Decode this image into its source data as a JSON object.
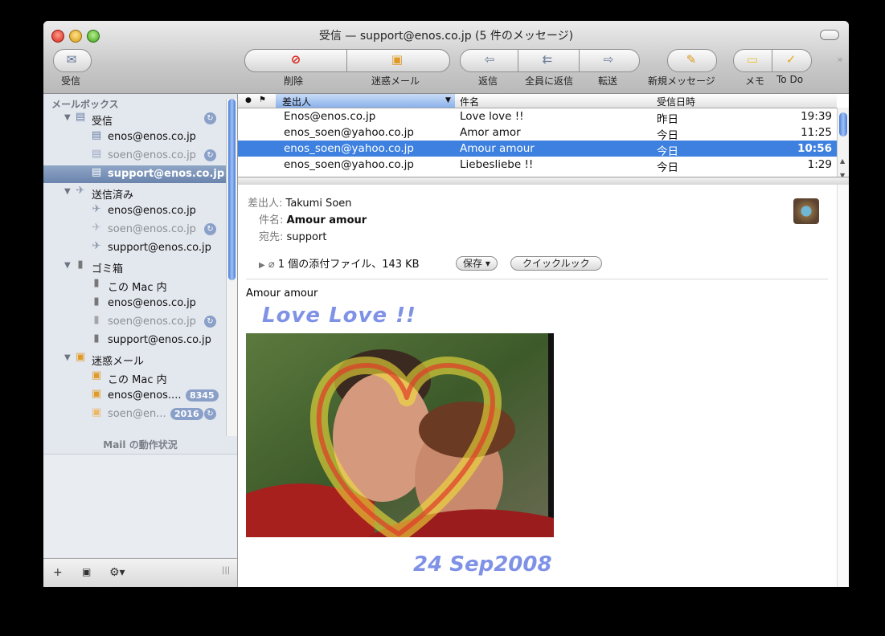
{
  "window": {
    "title": "受信 — support@enos.co.jp (5 件のメッセージ)"
  },
  "toolbar": {
    "get_mail": "受信",
    "delete": "削除",
    "junk": "迷惑メール",
    "reply": "返信",
    "reply_all": "全員に返信",
    "forward": "転送",
    "new_message": "新規メッセージ",
    "note": "メモ",
    "todo": "To Do"
  },
  "sidebar": {
    "header": "メールボックス",
    "inbox": "受信",
    "inbox_items": [
      "enos@enos.co.jp",
      "soen@enos.co.jp",
      "support@enos.co.jp"
    ],
    "sent": "送信済み",
    "sent_items": [
      "enos@enos.co.jp",
      "soen@enos.co.jp",
      "support@enos.co.jp"
    ],
    "trash": "ゴミ箱",
    "trash_items": [
      "この Mac 内",
      "enos@enos.co.jp",
      "soen@enos.co.jp",
      "support@enos.co.jp"
    ],
    "junk": "迷惑メール",
    "junk_items": [
      "この Mac 内",
      "enos@enos....",
      "soen@en..."
    ],
    "junk_counts": [
      "8345",
      "2016"
    ],
    "activity": "Mail の動作状況"
  },
  "list": {
    "columns": {
      "from": "差出人",
      "subject": "件名",
      "date": "受信日時"
    },
    "rows": [
      {
        "from": "Enos@enos.co.jp",
        "subject": "Love love !!",
        "date": "昨日",
        "time": "19:39"
      },
      {
        "from": "enos_soen@yahoo.co.jp",
        "subject": "Amor amor",
        "date": "今日",
        "time": "11:25"
      },
      {
        "from": "enos_soen@yahoo.co.jp",
        "subject": "Amour amour",
        "date": "今日",
        "time": "10:56"
      },
      {
        "from": "enos_soen@yahoo.co.jp",
        "subject": "Liebesliebe !!",
        "date": "今日",
        "time": "1:29"
      }
    ]
  },
  "message": {
    "from_label": "差出人:",
    "from": "Takumi Soen",
    "subject_label": "件名:",
    "subject": "Amour amour",
    "to_label": "宛先:",
    "to": "support",
    "attachments": "1 個の添付ファイル、143 KB",
    "save": "保存 ▾",
    "quicklook": "クイックルック",
    "body": "Amour amour",
    "handwriting_top": "Love Love !!",
    "handwriting_date": "24 Sep2008"
  },
  "colors": {
    "selection": "#3d80df",
    "sidebar_bg": "#e3e7ee",
    "handwriting": "#7f92e6"
  },
  "icons": [
    "get-mail-icon",
    "delete-icon",
    "junk-icon",
    "reply-icon",
    "reply-all-icon",
    "forward-icon",
    "new-message-icon",
    "note-icon",
    "todo-icon"
  ]
}
